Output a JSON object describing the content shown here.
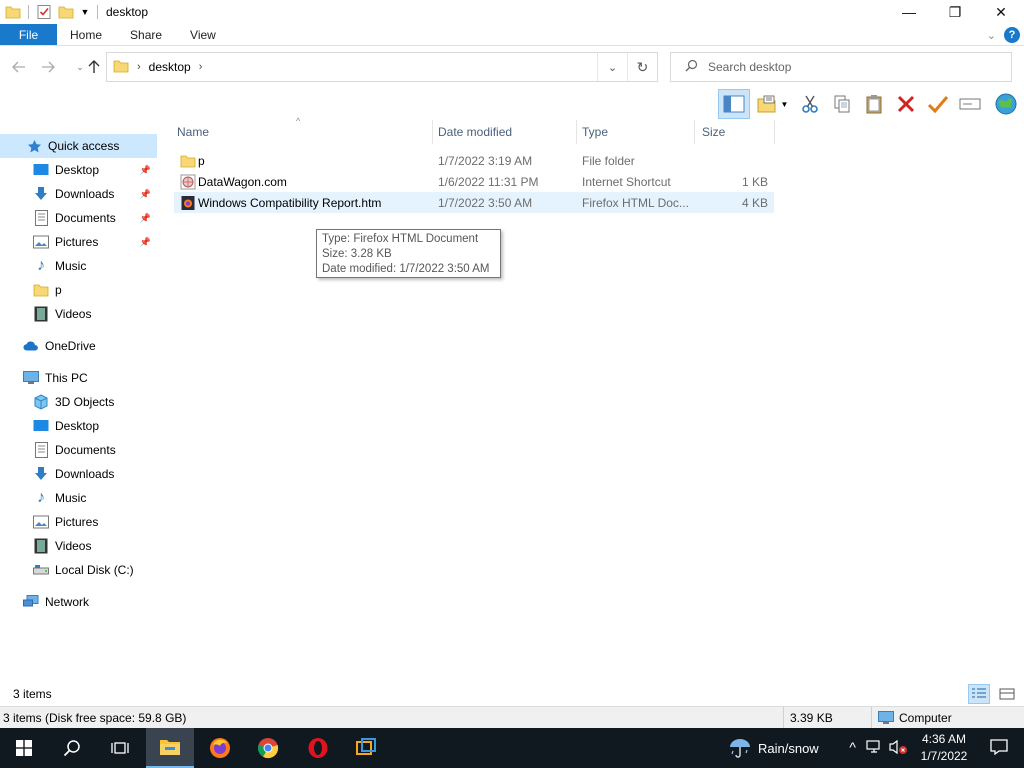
{
  "window": {
    "title": "desktop",
    "controls": {
      "minimize": "—",
      "maximize": "❐",
      "close": "✕"
    }
  },
  "ribbon": {
    "tabs": [
      "File",
      "Home",
      "Share",
      "View"
    ],
    "help": "?"
  },
  "address": {
    "path": "desktop",
    "search_placeholder": "Search desktop"
  },
  "nav_pane": {
    "quick_access": "Quick access",
    "quick_items": [
      {
        "label": "Desktop",
        "icon": "desktop-icon",
        "pinned": true
      },
      {
        "label": "Downloads",
        "icon": "download-icon",
        "pinned": true
      },
      {
        "label": "Documents",
        "icon": "document-icon",
        "pinned": true
      },
      {
        "label": "Pictures",
        "icon": "pictures-icon",
        "pinned": true
      },
      {
        "label": "Music",
        "icon": "music-icon",
        "pinned": false
      },
      {
        "label": "p",
        "icon": "folder-icon",
        "pinned": false
      },
      {
        "label": "Videos",
        "icon": "video-icon",
        "pinned": false
      }
    ],
    "onedrive": "OneDrive",
    "this_pc": "This PC",
    "pc_items": [
      {
        "label": "3D Objects",
        "icon": "cube-icon"
      },
      {
        "label": "Desktop",
        "icon": "desktop-icon"
      },
      {
        "label": "Documents",
        "icon": "document-icon"
      },
      {
        "label": "Downloads",
        "icon": "download-icon"
      },
      {
        "label": "Music",
        "icon": "music-icon"
      },
      {
        "label": "Pictures",
        "icon": "pictures-icon"
      },
      {
        "label": "Videos",
        "icon": "video-icon"
      },
      {
        "label": "Local Disk (C:)",
        "icon": "drive-icon"
      }
    ],
    "network": "Network"
  },
  "file_list": {
    "columns": [
      "Name",
      "Date modified",
      "Type",
      "Size"
    ],
    "rows": [
      {
        "name": "p",
        "date": "1/7/2022 3:19 AM",
        "type": "File folder",
        "size": "",
        "icon": "folder-icon"
      },
      {
        "name": "DataWagon.com",
        "date": "1/6/2022 11:31 PM",
        "type": "Internet Shortcut",
        "size": "1 KB",
        "icon": "internet-shortcut-icon"
      },
      {
        "name": "Windows Compatibility Report.htm",
        "date": "1/7/2022 3:50 AM",
        "type": "Firefox HTML Doc...",
        "size": "4 KB",
        "icon": "firefox-html-icon"
      }
    ],
    "tooltip": {
      "type": "Type: Firefox HTML Document",
      "size": "Size: 3.28 KB",
      "date": "Date modified: 1/7/2022 3:50 AM"
    }
  },
  "status": {
    "item_count": "3 items",
    "details": "3 items (Disk free space: 59.8 GB)",
    "size": "3.39 KB",
    "location": "Computer"
  },
  "taskbar": {
    "weather": "Rain/snow",
    "time": "4:36 AM",
    "date": "1/7/2022"
  },
  "colors": {
    "accent": "#1979ca",
    "selection": "#cce8ff",
    "taskbar": "#101820"
  }
}
